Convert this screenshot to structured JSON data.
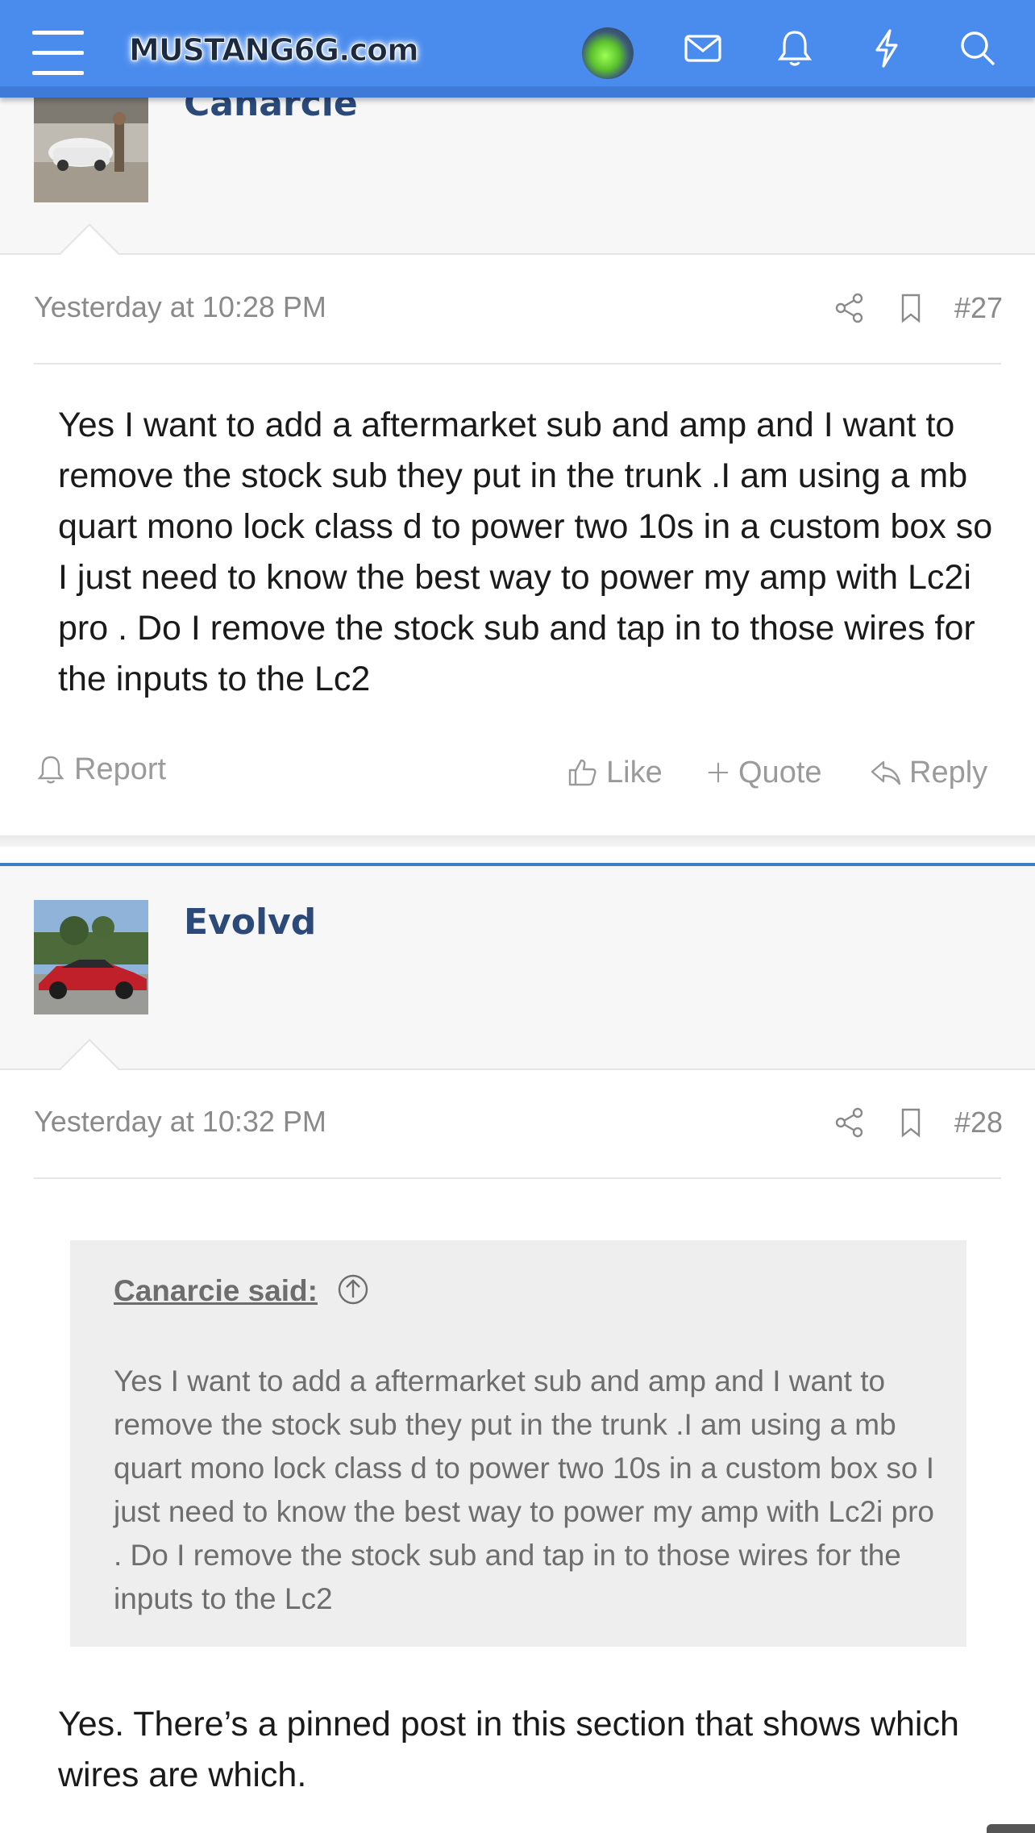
{
  "header": {
    "logo_text": "MUSTANG6G.com",
    "icons": [
      "menu-icon",
      "avatar",
      "mail-icon",
      "bell-icon",
      "bolt-icon",
      "search-icon"
    ]
  },
  "post27": {
    "username": "Canarcie",
    "timestamp": "Yesterday at 10:28 PM",
    "number": "#27",
    "body": "Yes I want to add a aftermarket sub and amp and I want to remove the stock sub they put in the trunk .I am using a mb quart mono lock class d to power two 10s in a custom box so I just need to know the best way to power my amp with Lc2i pro . Do I remove the stock sub and tap in to those wires for the inputs to the Lc2",
    "actions": {
      "report": "Report",
      "like": "Like",
      "quote": "Quote",
      "reply": "Reply"
    }
  },
  "post28": {
    "username": "Evolvd",
    "timestamp": "Yesterday at 10:32 PM",
    "number": "#28",
    "quote_author": "Canarcie said:",
    "quote_text": "Yes I want to add a aftermarket sub and amp and I want to remove the stock sub they put in the trunk .I am using a mb quart mono lock class d to power two 10s in a custom box so I just need to know the best way to power my amp with Lc2i pro . Do I remove the stock sub and tap in to those wires for the inputs to the Lc2",
    "body": "Yes. There’s a pinned post in this section that shows which wires are which."
  },
  "colors": {
    "header_bg": "#4a8cee",
    "username": "#2b4a7a",
    "muted": "#8a8a8a",
    "separator_blue": "#3f7fc4"
  }
}
